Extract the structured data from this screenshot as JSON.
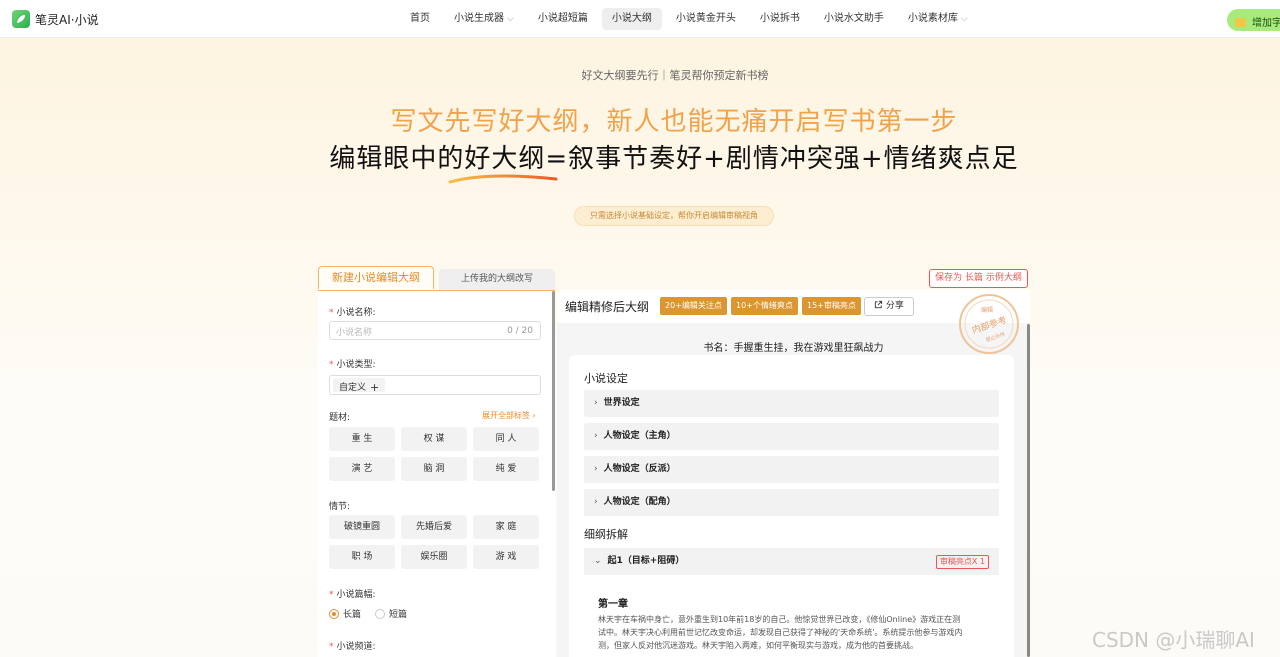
{
  "app": {
    "name": "笔灵AI·小说"
  },
  "nav": {
    "items": [
      {
        "label": "首页",
        "dropdown": false,
        "active": false
      },
      {
        "label": "小说生成器",
        "dropdown": true,
        "active": false
      },
      {
        "label": "小说超短篇",
        "dropdown": false,
        "active": false
      },
      {
        "label": "小说大纲",
        "dropdown": false,
        "active": true
      },
      {
        "label": "小说黄金开头",
        "dropdown": false,
        "active": false
      },
      {
        "label": "小说拆书",
        "dropdown": false,
        "active": false
      },
      {
        "label": "小说水文助手",
        "dropdown": false,
        "active": false
      },
      {
        "label": "小说素材库",
        "dropdown": true,
        "active": false
      }
    ],
    "login_label": "增加字数"
  },
  "hero": {
    "tagline": "好文大纲要先行｜笔灵帮你预定新书榜",
    "line1": "写文先写好大纲，新人也能无痛开启写书第一步",
    "line2": "编辑眼中的好大纲=叙事节奏好+剧情冲突强+情绪爽点足",
    "hint": "只需选择小说基础设定，帮你开启编辑审稿视角"
  },
  "form": {
    "tabs": [
      "新建小说编辑大纲",
      "上传我的大纲改写"
    ],
    "name_label": "小说名称:",
    "name_placeholder": "小说名称",
    "name_count": "0 / 20",
    "type_label": "小说类型:",
    "type_chip": "自定义",
    "theme_label": "题材:",
    "expand_label": "展开全部标签",
    "themes": [
      "重 生",
      "权 谋",
      "同 人",
      "演 艺",
      "脑 洞",
      "纯 爱"
    ],
    "plot_label": "情节:",
    "plots": [
      "破镜重圆",
      "先婚后爱",
      "家 庭",
      "职 场",
      "娱乐圈",
      "游 戏"
    ],
    "length_label": "小说篇幅:",
    "length_options": [
      "长篇",
      "短篇"
    ],
    "length_selected": "长篇",
    "channel_label": "小说频道:"
  },
  "result": {
    "save_label": "保存为 长篇 示例大纲",
    "title": "编辑精修后大纲",
    "badges": [
      "20+编辑关注点",
      "10+个情绪爽点",
      "15+审稿亮点"
    ],
    "share_label": "分享",
    "stamp_top": "编辑",
    "stamp_mid": "内部参考",
    "stamp_bottom": "禁止外传",
    "book_name": "书名：手握重生挂，我在游戏里狂飙战力",
    "setting_title": "小说设定",
    "settings": [
      "世界设定",
      "人物设定（主角）",
      "人物设定（反派）",
      "人物设定（配角）"
    ],
    "outline_title": "细纲拆解",
    "outline_item": "起1（目标+阻碍）",
    "outline_tag": "审稿亮点X 1",
    "chapter_title": "第一章",
    "chapter_text": "林天宇在车祸中身亡，意外重生到10年前18岁的自己。他惊觉世界已改变，《修仙Online》游戏正在测试中。林天宇决心利用前世记忆改变命运，却发现自己获得了神秘的'天命系统'。系统提示他参与游戏内测，但家人反对他沉迷游戏。林天宇陷入两难，如何平衡现实与游戏，成为他的首要挑战。"
  },
  "watermark": "CSDN @小瑞聊AI",
  "colors": {
    "accent": "#e58c2a",
    "badge": "#db9531",
    "danger": "#e55555",
    "hero_orange": "#f0a34a"
  }
}
